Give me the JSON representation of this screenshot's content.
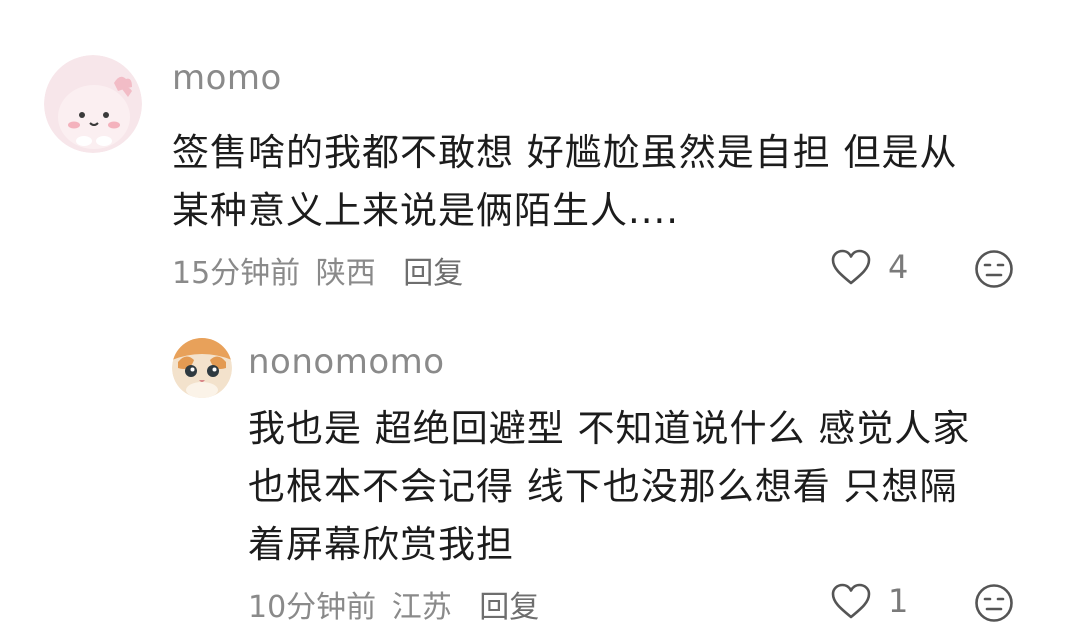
{
  "comments": [
    {
      "username": "momo",
      "lines": [
        "签售啥的我都不敢想 好尴尬虽然是自担 但是从",
        "某种意义上来说是俩陌生人...."
      ],
      "time": "15分钟前",
      "location": "陕西",
      "reply_label": "回复",
      "likes": "4",
      "avatar_icon": "pink-dino-avatar"
    },
    {
      "username": "nonomomo",
      "lines": [
        "我也是 超绝回避型 不知道说什么 感觉人家",
        "也根本不会记得 线下也没那么想看 只想隔",
        "着屏幕欣赏我担"
      ],
      "time": "10分钟前",
      "location": "江苏",
      "reply_label": "回复",
      "likes": "1",
      "avatar_icon": "orange-cat-avatar"
    }
  ],
  "colors": {
    "meta_gray": "#8a8a8a",
    "text": "#1c1c1c",
    "background": "#ffffff"
  }
}
